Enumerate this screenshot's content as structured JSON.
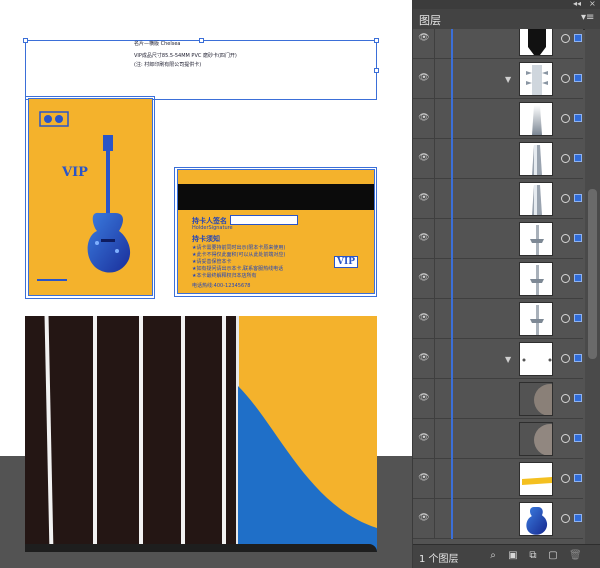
{
  "document": {
    "text_line_1": "名片—横版 Chelsea",
    "text_line_2": "VIP成品尺寸85.5-54MM PVC 磨砂卡(四门开)",
    "text_line_3": "(注: 村郎印刷有限公司提供卡)",
    "card_back": {
      "name_label": "持卡人签名",
      "sub_label": "HolderSignature",
      "notice_title": "持卡须知",
      "notice_items": [
        "★请卡需要持前同时出示(限本卡原来使用)",
        "★此卡不得仅此面积(可以从此处前端对应)",
        "★请妥善保管本卡",
        "★如有疑问请出示本卡,联系客服热线电话",
        "★本卡最终解释权归本店所有"
      ],
      "hotline": "电话热线:400-12345678"
    },
    "card_front": {
      "vip_text": "VIP"
    }
  },
  "layers_panel": {
    "title": "图层",
    "footer_count": "1 个图层",
    "collapse_icon": "double-arrow-icon",
    "menu_icon": "panel-menu-icon",
    "rows": [
      {
        "thumb": "dark-shape",
        "expand": false
      },
      {
        "thumb": "tuning-pegs",
        "expand": true
      },
      {
        "thumb": "peg-gradient",
        "expand": false
      },
      {
        "thumb": "peg-gradient",
        "expand": false
      },
      {
        "thumb": "peg-gradient",
        "expand": false
      },
      {
        "thumb": "string-line",
        "expand": false
      },
      {
        "thumb": "string-line",
        "expand": false
      },
      {
        "thumb": "string-line",
        "expand": false
      },
      {
        "thumb": "blank-dots",
        "expand": true
      },
      {
        "thumb": "gray-circle",
        "expand": false
      },
      {
        "thumb": "gray-circle",
        "expand": false
      },
      {
        "thumb": "yellow-bar",
        "expand": false
      },
      {
        "thumb": "blue-guitar-body",
        "expand": false
      }
    ],
    "footer_icons": [
      "search-icon",
      "make-clip-mask-icon",
      "new-sublayer-icon",
      "new-layer-icon",
      "delete-icon"
    ]
  },
  "colors": {
    "card_yellow": "#f4b22c",
    "accent_blue": "#2a55c8",
    "selection_blue": "#3b6fd8",
    "panel_bg": "#535353"
  }
}
